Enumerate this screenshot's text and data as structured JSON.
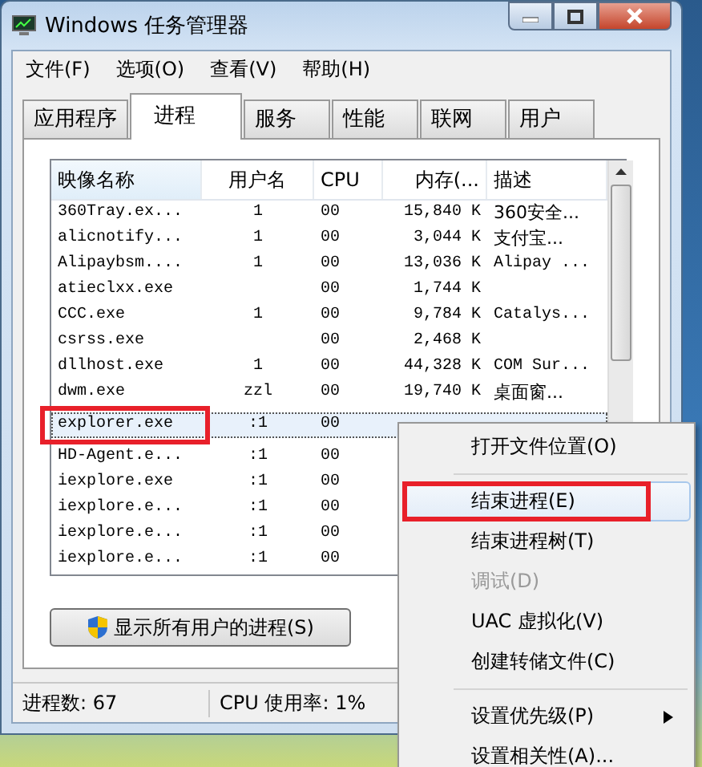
{
  "window": {
    "title": "Windows 任务管理器"
  },
  "menu_bar": [
    "文件(F)",
    "选项(O)",
    "查看(V)",
    "帮助(H)"
  ],
  "tabs": [
    {
      "label": "应用程序",
      "selected": false
    },
    {
      "label": "进程",
      "selected": true
    },
    {
      "label": "服务",
      "selected": false
    },
    {
      "label": "性能",
      "selected": false
    },
    {
      "label": "联网",
      "selected": false
    },
    {
      "label": "用户",
      "selected": false
    }
  ],
  "table": {
    "columns": [
      "映像名称",
      "用户名",
      "CPU",
      "内存(...",
      "描述"
    ],
    "rows": [
      {
        "cells": [
          "360Tray.ex...",
          "1",
          "00",
          "15,840 K",
          "360安全..."
        ],
        "selected": false,
        "highlighted": false
      },
      {
        "cells": [
          "alicnotify...",
          "1",
          "00",
          "3,044 K",
          "支付宝..."
        ],
        "selected": false,
        "highlighted": false
      },
      {
        "cells": [
          "Alipaybsm....",
          "1",
          "00",
          "13,036 K",
          "Alipay ..."
        ],
        "selected": false,
        "highlighted": false
      },
      {
        "cells": [
          "atieclxx.exe",
          "",
          "00",
          "1,744 K",
          ""
        ],
        "selected": false,
        "highlighted": false
      },
      {
        "cells": [
          "CCC.exe",
          "1",
          "00",
          "9,784 K",
          "Catalys..."
        ],
        "selected": false,
        "highlighted": false
      },
      {
        "cells": [
          "csrss.exe",
          "",
          "00",
          "2,468 K",
          ""
        ],
        "selected": false,
        "highlighted": false
      },
      {
        "cells": [
          "dllhost.exe",
          "1",
          "00",
          "44,328 K",
          "COM Sur..."
        ],
        "selected": false,
        "highlighted": false
      },
      {
        "cells": [
          "dwm.exe",
          "zzl",
          "00",
          "19,740 K",
          "桌面窗..."
        ],
        "selected": false,
        "highlighted": false
      },
      {
        "cells": [
          "explorer.exe",
          ":1",
          "00",
          "",
          ""
        ],
        "selected": true,
        "highlighted": true
      },
      {
        "cells": [
          "HD-Agent.e...",
          ":1",
          "00",
          "",
          ""
        ],
        "selected": false,
        "highlighted": false
      },
      {
        "cells": [
          "iexplore.exe",
          ":1",
          "00",
          "",
          ""
        ],
        "selected": false,
        "highlighted": false
      },
      {
        "cells": [
          "iexplore.e...",
          ":1",
          "00",
          "",
          ""
        ],
        "selected": false,
        "highlighted": false
      },
      {
        "cells": [
          "iexplore.e...",
          ":1",
          "00",
          "",
          ""
        ],
        "selected": false,
        "highlighted": false
      },
      {
        "cells": [
          "iexplore.e...",
          ":1",
          "00",
          "",
          ""
        ],
        "selected": false,
        "highlighted": false
      }
    ]
  },
  "show_all_button": "显示所有用户的进程(S)",
  "status_bar": [
    "进程数: 67",
    "CPU 使用率: 1%"
  ],
  "context_menu": [
    {
      "kind": "item",
      "label": "打开文件位置(O)",
      "disabled": false,
      "hovered": false,
      "highlighted": false,
      "submenu": false
    },
    {
      "kind": "separator"
    },
    {
      "kind": "item",
      "label": "结束进程(E)",
      "disabled": false,
      "hovered": true,
      "highlighted": true,
      "submenu": false
    },
    {
      "kind": "item",
      "label": "结束进程树(T)",
      "disabled": false,
      "hovered": false,
      "highlighted": false,
      "submenu": false
    },
    {
      "kind": "item",
      "label": "调试(D)",
      "disabled": true,
      "hovered": false,
      "highlighted": false,
      "submenu": false
    },
    {
      "kind": "item",
      "label": "UAC 虚拟化(V)",
      "disabled": false,
      "hovered": false,
      "highlighted": false,
      "submenu": false
    },
    {
      "kind": "item",
      "label": "创建转储文件(C)",
      "disabled": false,
      "hovered": false,
      "highlighted": false,
      "submenu": false
    },
    {
      "kind": "separator"
    },
    {
      "kind": "item",
      "label": "设置优先级(P)",
      "disabled": false,
      "hovered": false,
      "highlighted": false,
      "submenu": true
    },
    {
      "kind": "item",
      "label": "设置相关性(A)...",
      "disabled": false,
      "hovered": false,
      "highlighted": false,
      "submenu": false
    }
  ]
}
